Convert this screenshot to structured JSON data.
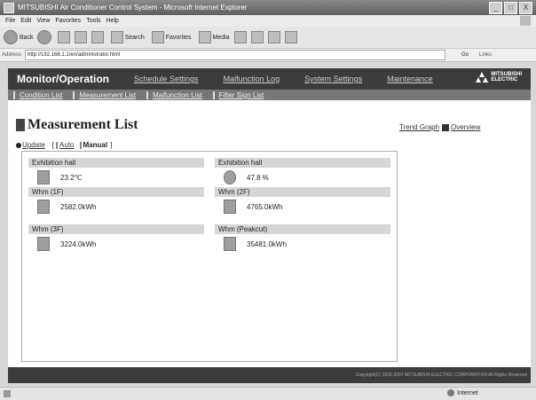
{
  "window": {
    "title": "MITSUBISHI Air Conditioner Control System - Microsoft Internet Explorer",
    "controls": [
      "_",
      "□",
      "X"
    ]
  },
  "menubar": [
    "File",
    "Edit",
    "View",
    "Favorites",
    "Tools",
    "Help"
  ],
  "toolbar": {
    "back": "Back",
    "search": "Search",
    "favorites": "Favorites",
    "media": "Media"
  },
  "address": {
    "label": "Address",
    "url": "http://192.168.1.1/en/administrator.html",
    "go": "Go",
    "links": "Links"
  },
  "nav": {
    "brand": "Monitor/Operation",
    "items": [
      "Schedule Settings",
      "Malfunction Log",
      "System Settings",
      "Maintenance"
    ],
    "logo_line1": "MITSUBISHI",
    "logo_line2": "ELECTRIC"
  },
  "subnav": [
    "Condition List",
    "Measurement List",
    "Malfunction List",
    "Filter Sign List"
  ],
  "page": {
    "title": "Measurement List",
    "trend_graph": "Trend Graph",
    "overview": "Overview",
    "update": "Update",
    "auto": "Auto",
    "manual": "Manual",
    "bracket_open": "[",
    "bracket_close": "]"
  },
  "measurements": [
    {
      "label": "Exhibition hall",
      "value": "23.2",
      "unit": "℃",
      "icon": "thermometer-icon"
    },
    {
      "label": "Exhibition hall",
      "value": "47.8",
      "unit": "%",
      "icon": "humidity-icon"
    },
    {
      "label": "Whm (1F)",
      "value": "2582.0",
      "unit": "kWh",
      "icon": "meter-icon"
    },
    {
      "label": "Whm (2F)",
      "value": "4765.0",
      "unit": "kWh",
      "icon": "meter-icon"
    },
    {
      "label": "Whm (3F)",
      "value": "3224.0",
      "unit": "kWh",
      "icon": "meter-icon"
    },
    {
      "label": "Whm (Peakcut)",
      "value": "35481.0",
      "unit": "kWh",
      "icon": "meter-icon"
    }
  ],
  "footer": "Copyright(C) 2002-2007 MITSUBISHI ELECTRIC CORPORATION All Rights Reserved",
  "status": {
    "zone": "Internet"
  }
}
